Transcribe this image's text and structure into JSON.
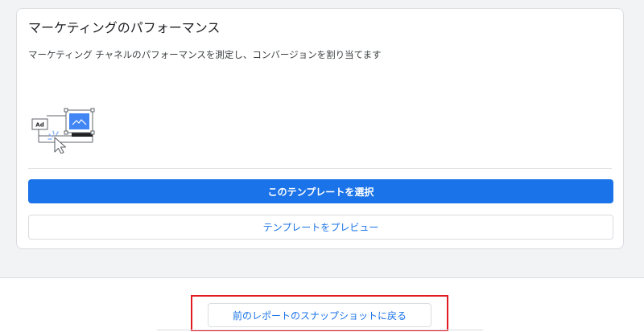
{
  "card": {
    "title": "マーケティングのパフォーマンス",
    "description": "マーケティング チャネルのパフォーマンスを測定し、コンバージョンを割り当てます",
    "illustration": {
      "ad_label": "Ad",
      "icons": [
        "ad-box-icon",
        "image-placeholder-icon",
        "mouse-cursor-icon",
        "click-burst-icon"
      ]
    },
    "select_button_label": "このテンプレートを選択",
    "preview_button_label": "テンプレートをプレビュー"
  },
  "footer": {
    "back_button_label": "前のレポートのスナップショットに戻る"
  },
  "colors": {
    "accent": "#1a73e8",
    "highlight": "#e11b22",
    "background": "#f1f3f4",
    "card": "#ffffff",
    "border": "#dadce0"
  }
}
